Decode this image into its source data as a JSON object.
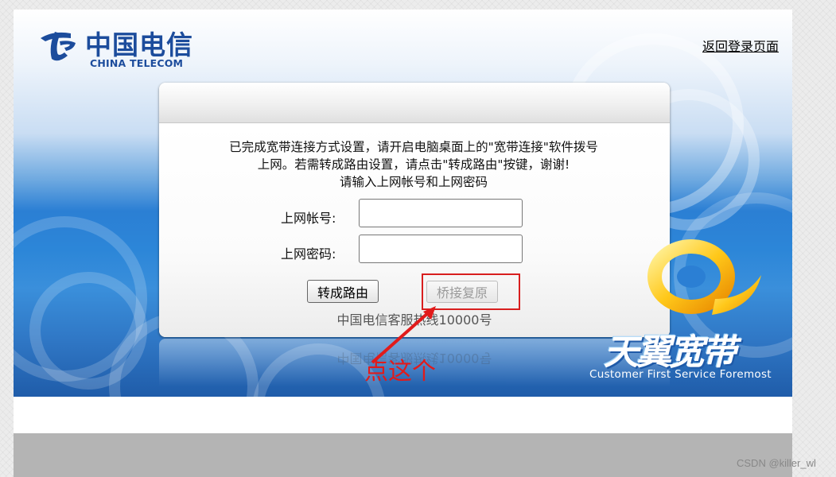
{
  "header": {
    "logo_cn": "中国电信",
    "logo_en": "CHINA TELECOM",
    "return_link": "返回登录页面"
  },
  "panel": {
    "message_line1": "已完成宽带连接方式设置，请开启电脑桌面上的\"宽带连接\"软件拨号",
    "message_line2": "上网。若需转成路由设置，请点击\"转成路由\"按键，谢谢!",
    "message_line3": "请输入上网帐号和上网密码",
    "account_label": "上网帐号:",
    "account_value": "",
    "password_label": "上网密码:",
    "password_value": "",
    "router_button": "转成路由",
    "bridge_button": "桥接复原",
    "hotline": "中国电信客服热线10000号"
  },
  "annotation": {
    "text": "点这个",
    "color": "#e11b1b"
  },
  "brand": {
    "name_cn": "天翼宽带",
    "slogan": "Customer First Service Foremost"
  },
  "watermark": "CSDN @killer_wl",
  "colors": {
    "telecom_blue": "#1c4c9c",
    "hero_blue": "#2b7fd4",
    "highlight_red": "#d81e1e",
    "footer_gray": "#b4b4b4"
  }
}
